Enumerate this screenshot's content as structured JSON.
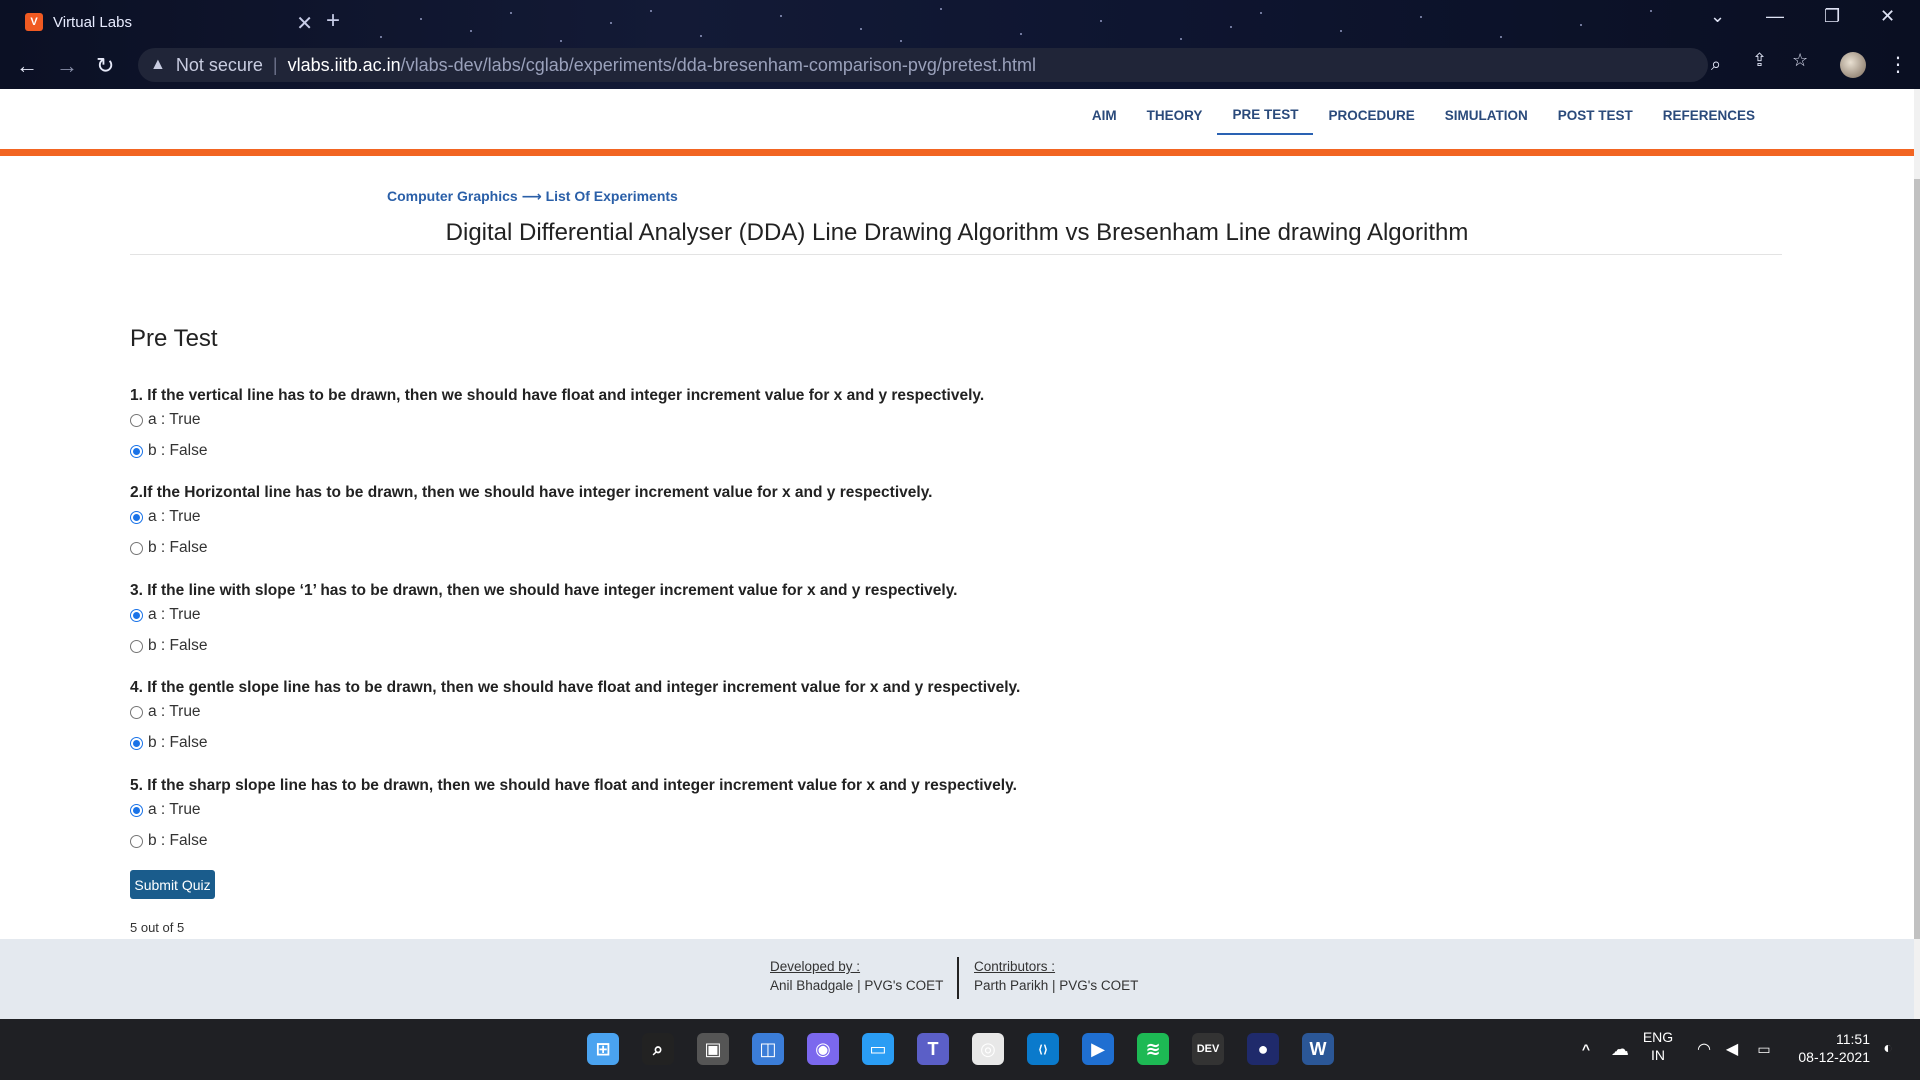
{
  "browser": {
    "tab_title": "Virtual Labs",
    "tab_favicon_text": "V",
    "omnibox": {
      "security_label": "Not secure",
      "url_host": "vlabs.iitb.ac.in",
      "url_path": "/vlabs-dev/labs/cglab/experiments/dda-bresenham-comparison-pvg/pretest.html"
    }
  },
  "nav": {
    "items": [
      "AIM",
      "THEORY",
      "PRE TEST",
      "PROCEDURE",
      "SIMULATION",
      "POST TEST",
      "REFERENCES"
    ],
    "active_index": 2
  },
  "breadcrumb": {
    "root": "Computer Graphics",
    "arrow": "⟶",
    "leaf": "List Of Experiments"
  },
  "page_title": "Digital Differential Analyser (DDA) Line Drawing Algorithm vs Bresenham Line drawing Algorithm",
  "section_heading": "Pre Test",
  "questions": [
    {
      "text": "1. If the vertical line has to be drawn, then we should have float and integer increment value for x and y respectively.",
      "options": [
        "a : True",
        "b : False"
      ],
      "selected": 1
    },
    {
      "text": "2.If the Horizontal line has to be drawn, then we should have integer increment value for x and y respectively.",
      "options": [
        "a : True",
        "b : False"
      ],
      "selected": 0
    },
    {
      "text": "3. If the line with slope ‘1’ has to be drawn, then we should have integer increment value for x and y respectively.",
      "options": [
        "a : True",
        "b : False"
      ],
      "selected": 0
    },
    {
      "text": "4. If the gentle slope line has to be drawn, then we should have float and integer increment value for x and y respectively.",
      "options": [
        "a : True",
        "b : False"
      ],
      "selected": 1
    },
    {
      "text": "5. If the sharp slope line has to be drawn, then we should have float and integer increment value for x and y respectively.",
      "options": [
        "a : True",
        "b : False"
      ],
      "selected": 0
    }
  ],
  "submit_label": "Submit Quiz",
  "score_text": "5 out of 5",
  "footer": {
    "developed_heading": "Developed by :",
    "developed_value": "Anil Bhadgale | PVG's COET",
    "contributors_heading": "Contributors :",
    "contributors_value": "Parth Parikh | PVG's COET"
  },
  "taskbar": {
    "lang_top": "ENG",
    "lang_bottom": "IN",
    "time": "11:51",
    "date": "08-12-2021",
    "apps": [
      "start-icon",
      "search-icon",
      "task-view-icon",
      "widgets-icon",
      "teams-chat-icon",
      "desktop-icon",
      "teams-icon",
      "chrome-icon",
      "vscode-icon",
      "prime-video-icon",
      "spotify-icon",
      "dev-icon",
      "app-icon",
      "word-icon"
    ]
  },
  "colors": {
    "accent_orange": "#f26522",
    "link_blue": "#2a5fa8",
    "button_blue": "#1a5c8c",
    "radio_blue": "#1a73e8"
  }
}
